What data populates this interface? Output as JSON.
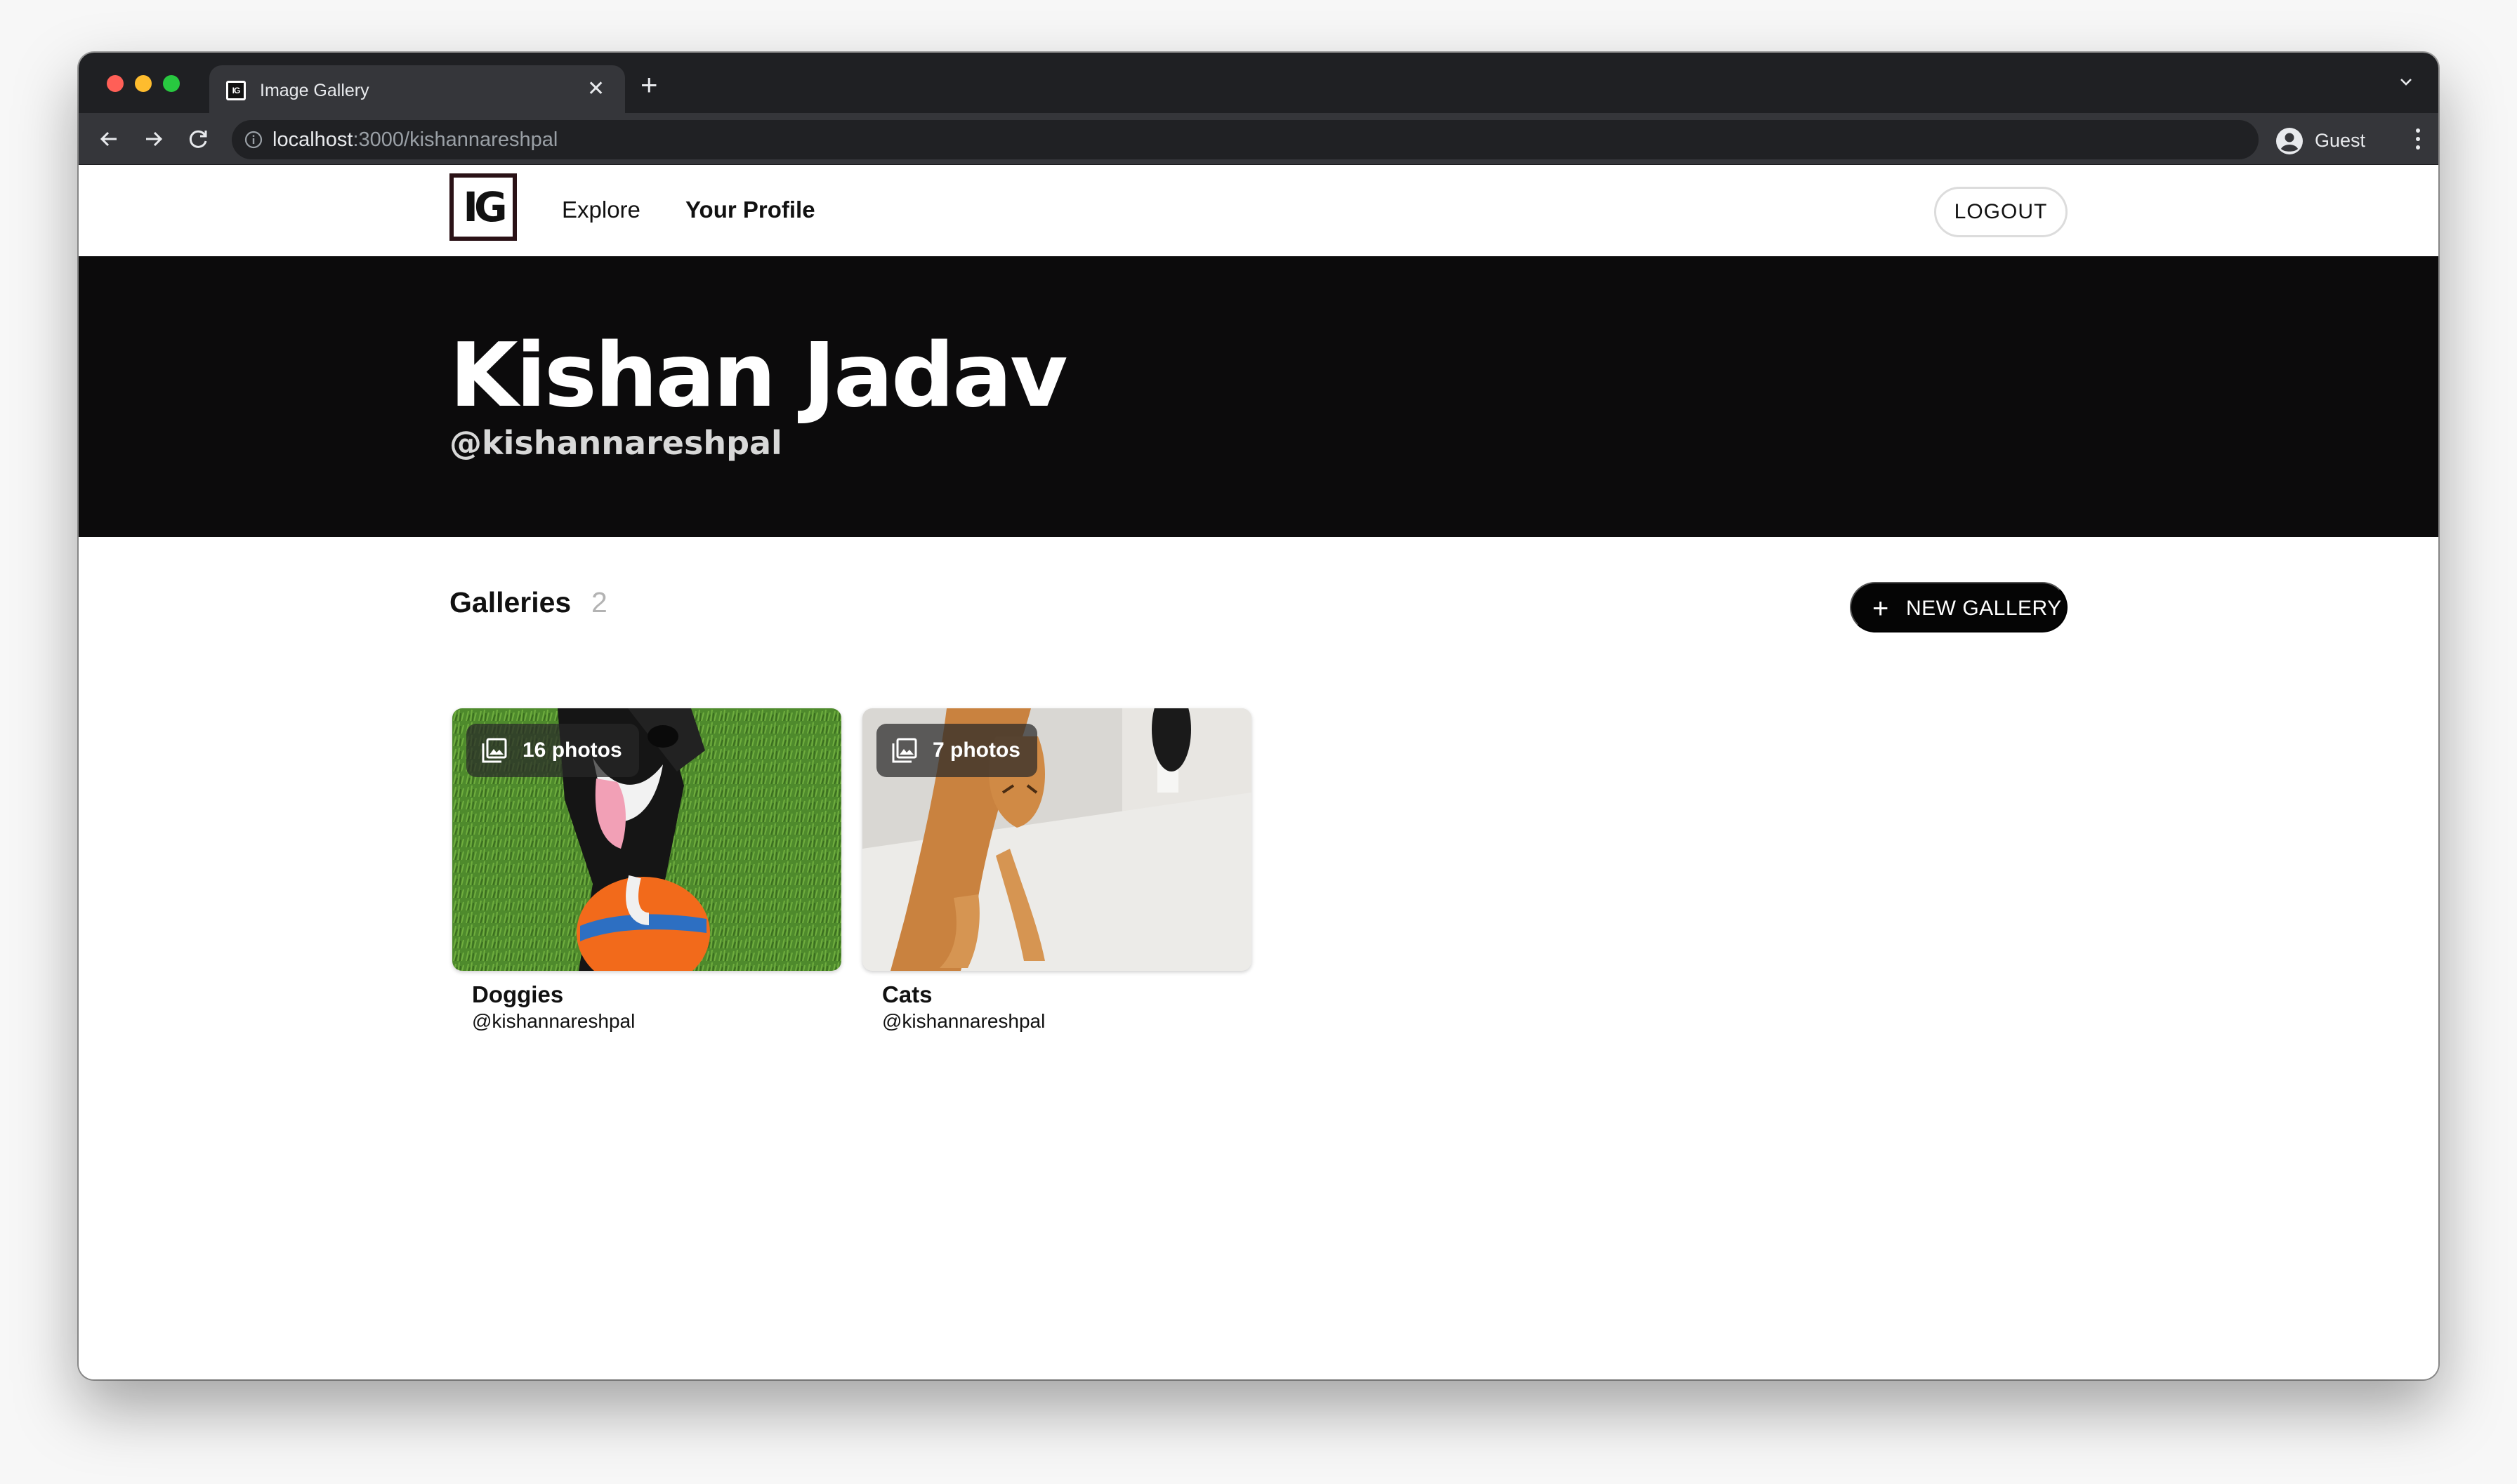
{
  "browser": {
    "tab_title": "Image Gallery",
    "tab_favicon_text": "IG",
    "url_host": "localhost",
    "url_path": ":3000/kishannareshpal",
    "profile_name": "Guest"
  },
  "nav": {
    "logo_text": "IG",
    "explore_label": "Explore",
    "profile_label": "Your Profile",
    "logout_label": "LOGOUT"
  },
  "hero": {
    "name": "Kishan Jadav",
    "handle": "@kishannareshpal"
  },
  "galleries": {
    "heading": "Galleries",
    "count": "2",
    "new_button_label": "NEW GALLERY",
    "items": [
      {
        "title": "Doggies",
        "owner": "@kishannareshpal",
        "photo_count": "16 photos"
      },
      {
        "title": "Cats",
        "owner": "@kishannareshpal",
        "photo_count": "7 photos"
      }
    ]
  },
  "colors": {
    "hero_bg": "#0c0b0c",
    "primary_button": "#050505",
    "chrome_dark": "#1f2023",
    "chrome_toolbar": "#35363a"
  },
  "icons": [
    "close-icon",
    "plus-icon",
    "back-arrow-icon",
    "forward-arrow-icon",
    "reload-icon",
    "info-icon",
    "account-icon",
    "kebab-menu-icon",
    "chevron-down-icon",
    "photo-library-icon"
  ]
}
